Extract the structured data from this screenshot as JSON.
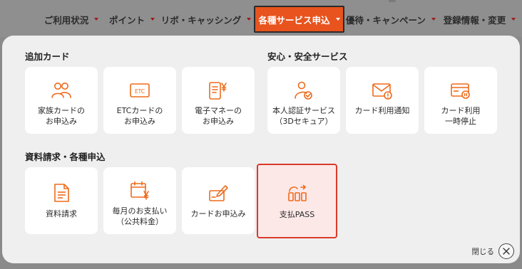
{
  "colors": {
    "accent": "#e8531e",
    "icon": "#ee6a1a",
    "selected_border": "#d93b2b",
    "selected_bg": "#fde8e8"
  },
  "nav": {
    "items": [
      {
        "label": "ご利用状況"
      },
      {
        "label": "ポイント"
      },
      {
        "label": "リボ・キャッシング"
      },
      {
        "label": "各種サービス申込",
        "active": true
      },
      {
        "label": "優待・キャンペーン"
      },
      {
        "label": "登録情報・変更"
      }
    ]
  },
  "sections": {
    "additional_cards": {
      "title": "追加カード",
      "tiles": [
        {
          "label": "家族カードの\nお申込み",
          "icon": "family-icon"
        },
        {
          "label": "ETCカードの\nお申込み",
          "icon": "etc-card-icon"
        },
        {
          "label": "電子マネーの\nお申込み",
          "icon": "e-money-icon"
        }
      ]
    },
    "security": {
      "title": "安心・安全サービス",
      "tiles": [
        {
          "label": "本人認証サービス\n（3Dセキュア）",
          "icon": "verified-user-icon"
        },
        {
          "label": "カード利用通知",
          "icon": "mail-notice-icon"
        },
        {
          "label": "カード利用\n一時停止",
          "icon": "card-pause-icon"
        }
      ]
    },
    "documents": {
      "title": "資料請求・各種申込",
      "tiles": [
        {
          "label": "資料請求",
          "icon": "document-icon"
        },
        {
          "label": "毎月のお支払い\n（公共料金）",
          "icon": "calendar-yen-icon"
        },
        {
          "label": "カードお申込み",
          "icon": "application-pen-icon"
        },
        {
          "label": "支払PASS",
          "icon": "pay-pass-icon",
          "selected": true
        }
      ]
    }
  },
  "close": {
    "label": "閉じる"
  }
}
